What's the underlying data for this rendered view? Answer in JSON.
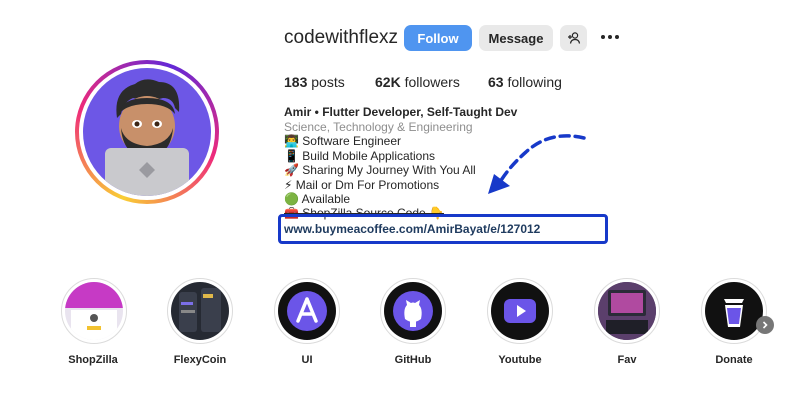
{
  "profile": {
    "username": "codewithflexz",
    "follow_label": "Follow",
    "message_label": "Message"
  },
  "stats": {
    "posts_count": "183",
    "posts_label": "posts",
    "followers_count": "62K",
    "followers_label": "followers",
    "following_count": "63",
    "following_label": "following"
  },
  "bio": {
    "name": "Amir • Flutter Developer, Self-Taught Dev",
    "category": "Science, Technology & Engineering",
    "lines": [
      "👨‍💻 Software Engineer",
      "📱 Build Mobile Applications",
      "🚀 Sharing My Journey With You All",
      "⚡ Mail or Dm For Promotions",
      "🟢 Available",
      "🧰 ShopZilla Source Code 👇"
    ],
    "link": "www.buymeacoffee.com/AmirBayat/e/127012"
  },
  "highlights": [
    {
      "label": "ShopZilla"
    },
    {
      "label": "FlexyCoin"
    },
    {
      "label": "UI"
    },
    {
      "label": "GitHub"
    },
    {
      "label": "Youtube"
    },
    {
      "label": "Fav"
    },
    {
      "label": "Donate"
    }
  ],
  "colors": {
    "follow_blue": "#4f95f0",
    "annotation_blue": "#1739c9",
    "highlight_purple": "#6b55e8"
  }
}
